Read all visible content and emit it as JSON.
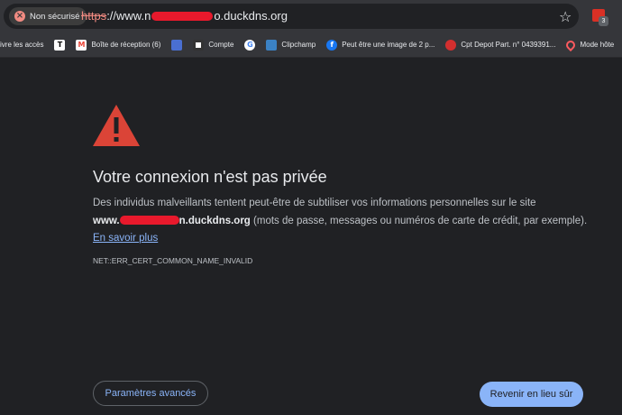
{
  "omnibox": {
    "security_label": "Non sécurisé",
    "url_scheme": "https",
    "url_prefix": "://www.n",
    "url_suffix": "o.duckdns.org"
  },
  "extension": {
    "badge": "3"
  },
  "bookmarks": [
    {
      "label": "ivre les accès",
      "icon": "apps-icon"
    },
    {
      "label": "",
      "icon": "tinfo-icon",
      "glyph": "T"
    },
    {
      "label": "Boîte de réception (6)",
      "icon": "gmail-icon",
      "glyph": "M"
    },
    {
      "label": "",
      "icon": "portal-icon",
      "glyph": ""
    },
    {
      "label": "Compte",
      "icon": "account-icon",
      "glyph": ""
    },
    {
      "label": "",
      "icon": "google-icon",
      "glyph": "G"
    },
    {
      "label": "Clipchamp",
      "icon": "clipchamp-icon",
      "glyph": ""
    },
    {
      "label": "Peut être une image de 2 p...",
      "icon": "facebook-icon",
      "glyph": "f"
    },
    {
      "label": "Cpt Depot Part. n° 0439391...",
      "icon": "bank-icon",
      "glyph": ""
    },
    {
      "label": "Mode hôte",
      "icon": "airbnb-icon",
      "glyph": ""
    }
  ],
  "error_page": {
    "title": "Votre connexion n'est pas privée",
    "desc_part1": "Des individus malveillants tentent peut-être de subtiliser vos informations personnelles sur le site",
    "host_prefix": "www.",
    "host_suffix": "n.duckdns.org",
    "desc_part2": " (mots de passe, messages ou numéros de carte de crédit, par exemple).",
    "learn_more": "En savoir plus",
    "error_code": "NET::ERR_CERT_COMMON_NAME_INVALID",
    "advanced_button": "Paramètres avancés",
    "back_button": "Revenir en lieu sûr"
  },
  "colors": {
    "background": "#202124",
    "accent": "#8ab4f8",
    "warning": "#db4437"
  }
}
